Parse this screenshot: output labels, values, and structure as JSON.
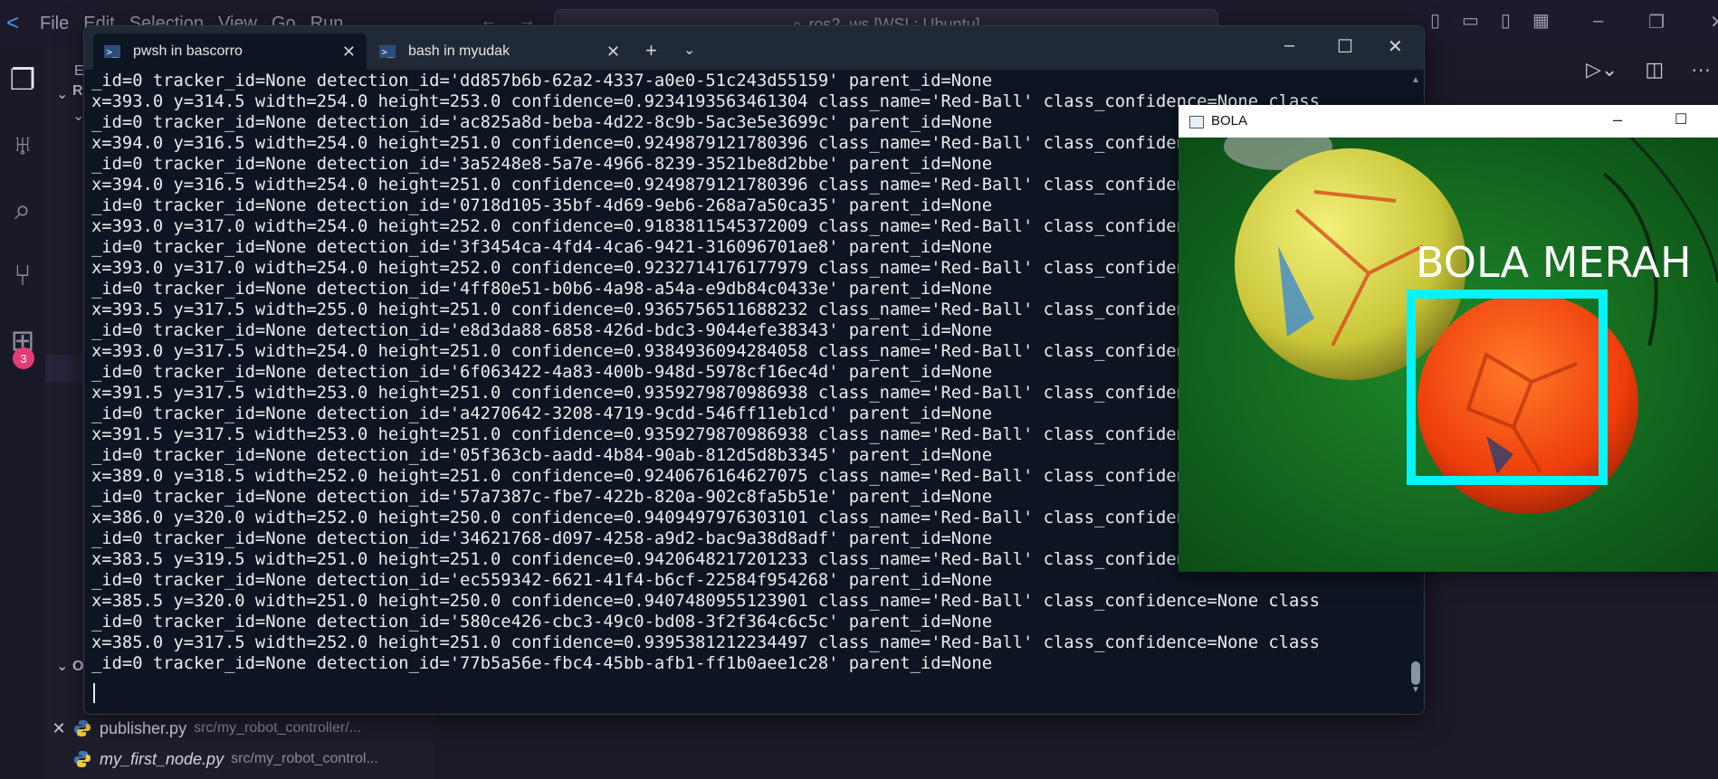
{
  "vscode": {
    "menu": [
      "File",
      "Edit",
      "Selection",
      "View",
      "Go",
      "Run",
      "..."
    ],
    "search_text": "ros2_ws [WSL: Ubuntu]",
    "activity_badge": "3",
    "sidebar_header": "E",
    "section_r": "R",
    "section_o": "O",
    "open_editors": [
      {
        "file": "publisher.py",
        "path": "src/my_robot_controller/..."
      },
      {
        "file": "my_first_node.py",
        "path": "src/my_robot_control..."
      }
    ]
  },
  "terminal": {
    "tabs": [
      {
        "label": "pwsh in bascorro",
        "active": true
      },
      {
        "label": "bash in myudak",
        "active": false
      }
    ],
    "lines": [
      "_id=0 tracker_id=None detection_id='dd857b6b-62a2-4337-a0e0-51c243d55159' parent_id=None",
      "x=393.0 y=314.5 width=254.0 height=253.0 confidence=0.9234193563461304 class_name='Red-Ball' class_confidence=None class",
      "_id=0 tracker_id=None detection_id='ac825a8d-beba-4d22-8c9b-5ac3e5e3699c' parent_id=None",
      "x=394.0 y=316.5 width=254.0 height=251.0 confidence=0.9249879121780396 class_name='Red-Ball' class_confidence=None class",
      "_id=0 tracker_id=None detection_id='3a5248e8-5a7e-4966-8239-3521be8d2bbe' parent_id=None",
      "x=394.0 y=316.5 width=254.0 height=251.0 confidence=0.9249879121780396 class_name='Red-Ball' class_confidence=None class",
      "_id=0 tracker_id=None detection_id='0718d105-35bf-4d69-9eb6-268a7a50ca35' parent_id=None",
      "x=393.0 y=317.0 width=254.0 height=252.0 confidence=0.9183811545372009 class_name='Red-Ball' class_confidence=None class",
      "_id=0 tracker_id=None detection_id='3f3454ca-4fd4-4ca6-9421-316096701ae8' parent_id=None",
      "x=393.0 y=317.0 width=254.0 height=252.0 confidence=0.9232714176177979 class_name='Red-Ball' class_confidence=None class",
      "_id=0 tracker_id=None detection_id='4ff80e51-b0b6-4a98-a54a-e9db84c0433e' parent_id=None",
      "x=393.5 y=317.5 width=255.0 height=251.0 confidence=0.9365756511688232 class_name='Red-Ball' class_confidence=None class",
      "_id=0 tracker_id=None detection_id='e8d3da88-6858-426d-bdc3-9044efe38343' parent_id=None",
      "x=393.0 y=317.5 width=254.0 height=251.0 confidence=0.9384936094284058 class_name='Red-Ball' class_confidence=None class",
      "_id=0 tracker_id=None detection_id='6f063422-4a83-400b-948d-5978cf16ec4d' parent_id=None",
      "x=391.5 y=317.5 width=253.0 height=251.0 confidence=0.9359279870986938 class_name='Red-Ball' class_confidence=None class",
      "_id=0 tracker_id=None detection_id='a4270642-3208-4719-9cdd-546ff11eb1cd' parent_id=None",
      "x=391.5 y=317.5 width=253.0 height=251.0 confidence=0.9359279870986938 class_name='Red-Ball' class_confidence=None class",
      "_id=0 tracker_id=None detection_id='05f363cb-aadd-4b84-90ab-812d5d8b3345' parent_id=None",
      "x=389.0 y=318.5 width=252.0 height=251.0 confidence=0.9240676164627075 class_name='Red-Ball' class_confidence=None class",
      "_id=0 tracker_id=None detection_id='57a7387c-fbe7-422b-820a-902c8fa5b51e' parent_id=None",
      "x=386.0 y=320.0 width=252.0 height=250.0 confidence=0.9409497976303101 class_name='Red-Ball' class_confidence=None class",
      "_id=0 tracker_id=None detection_id='34621768-d097-4258-a9d2-bac9a38d8adf' parent_id=None",
      "x=383.5 y=319.5 width=251.0 height=251.0 confidence=0.9420648217201233 class_name='Red-Ball' class_confidence=None class",
      "_id=0 tracker_id=None detection_id='ec559342-6621-41f4-b6cf-22584f954268' parent_id=None",
      "x=385.5 y=320.0 width=251.0 height=250.0 confidence=0.9407480955123901 class_name='Red-Ball' class_confidence=None class",
      "_id=0 tracker_id=None detection_id='580ce426-cbc3-49c0-bd08-3f2f364c6c5c' parent_id=None",
      "x=385.0 y=317.5 width=252.0 height=251.0 confidence=0.9395381212234497 class_name='Red-Ball' class_confidence=None class",
      "_id=0 tracker_id=None detection_id='77b5a56e-fbc4-45bb-afb1-ff1b0aee1c28' parent_id=None"
    ]
  },
  "bola_window": {
    "title": "BOLA",
    "detection_label": "BOLA MERAH",
    "box_color": "#00f5ff"
  },
  "colors": {
    "terminal_bg": "#0c1521",
    "terminal_text": "#e9ecef",
    "accent": "#3b9ef0",
    "badge": "#e43b7a"
  }
}
